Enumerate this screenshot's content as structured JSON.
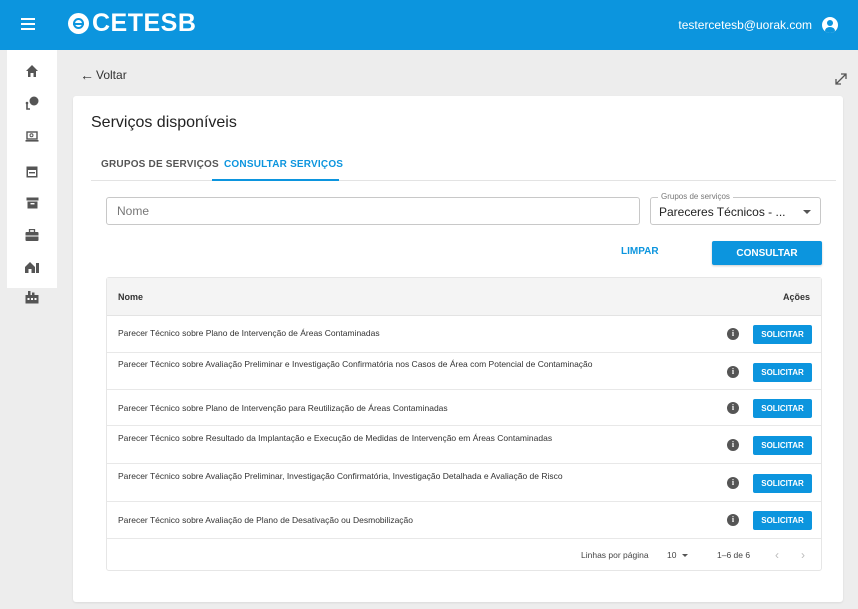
{
  "app": {
    "logo_text": "CETESB",
    "user_email": "testercetesb@uorak.com"
  },
  "sidebar": {
    "items": [
      {
        "icon": "home-icon"
      },
      {
        "icon": "map-pin-icon"
      },
      {
        "icon": "laptop-search-icon"
      },
      {
        "icon": "calendar-icon"
      },
      {
        "icon": "archive-icon"
      },
      {
        "icon": "briefcase-icon"
      },
      {
        "icon": "house-building-icon"
      },
      {
        "icon": "factory-icon"
      }
    ]
  },
  "nav": {
    "back_label": "Voltar"
  },
  "page": {
    "title": "Serviços disponíveis",
    "tabs": [
      {
        "label": "GRUPOS DE SERVIÇOS",
        "active": false
      },
      {
        "label": "CONSULTAR SERVIÇOS",
        "active": true
      }
    ]
  },
  "filters": {
    "name_placeholder": "Nome",
    "name_value": "",
    "group_label": "Grupos de serviços",
    "group_value": "Pareceres Técnicos - ...",
    "clear_label": "LIMPAR",
    "search_label": "CONSULTAR"
  },
  "table": {
    "col_name": "Nome",
    "col_actions": "Ações",
    "action_label": "SOLICITAR",
    "rows": [
      {
        "name": "Parecer Técnico sobre Plano de Intervenção de Áreas Contaminadas"
      },
      {
        "name": "Parecer Técnico sobre Avaliação Preliminar e Investigação Confirmatória nos Casos de Área com Potencial de Contaminação"
      },
      {
        "name": "Parecer Técnico sobre Plano de Intervenção para Reutilização de Áreas Contaminadas"
      },
      {
        "name": "Parecer Técnico sobre Resultado da Implantação e Execução de Medidas de Intervenção em Áreas Contaminadas"
      },
      {
        "name": "Parecer Técnico sobre Avaliação Preliminar, Investigação Confirmatória, Investigação Detalhada e Avaliação de Risco"
      },
      {
        "name": "Parecer Técnico sobre Avaliação de Plano de Desativação ou Desmobilização"
      }
    ]
  },
  "pagination": {
    "rows_per_page_label": "Linhas por página",
    "rows_per_page": "10",
    "range": "1–6 de 6"
  },
  "colors": {
    "brand": "#0c95de",
    "background": "#ededed"
  }
}
